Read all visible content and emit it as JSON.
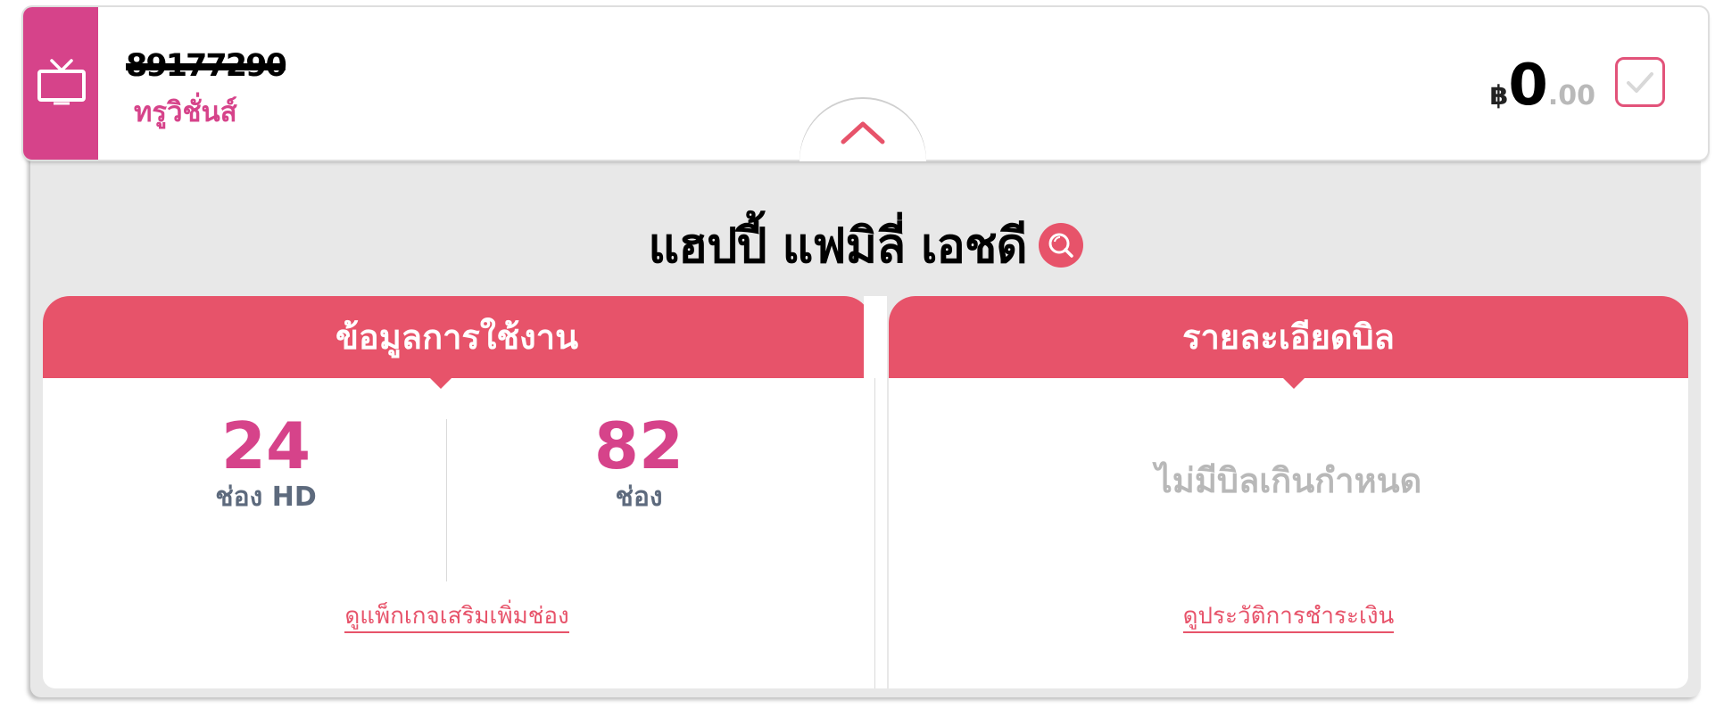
{
  "account": {
    "number_redacted": "89177290",
    "service_name": "ทรูวิชั่นส์",
    "icon": "tv-icon"
  },
  "balance": {
    "currency": "฿",
    "integer": "0",
    "decimals": ".00"
  },
  "plan": {
    "name": "แฮปปี้ แฟมิลี่ เอชดี",
    "search_icon": "search-icon"
  },
  "usage": {
    "title": "ข้อมูลการใช้งาน",
    "hd_channels": {
      "value": "24",
      "label": "ช่อง HD"
    },
    "channels": {
      "value": "82",
      "label": "ช่อง"
    },
    "link": "ดูแพ็กเกจเสริมเพิ่มช่อง"
  },
  "bill": {
    "title": "รายละเอียดบิล",
    "status": "ไม่มีบิลเกินกำหนด",
    "link": "ดูประวัติการชำระเงิน"
  },
  "colors": {
    "brand_pink": "#d6438a",
    "accent_red": "#e7536a",
    "panel_grey": "#e8e8e8"
  }
}
